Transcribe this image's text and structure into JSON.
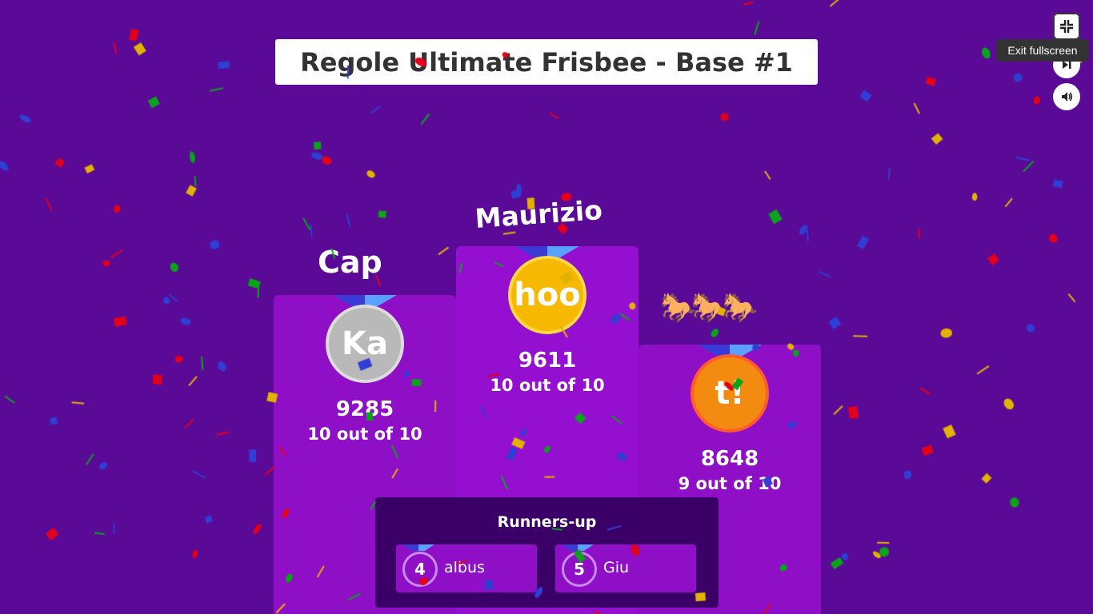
{
  "title": "Regole Ultimate Frisbee - Base #1",
  "controls": {
    "tooltip": "Exit fullscreen",
    "fullscreen_icon": "exit-fullscreen-icon",
    "skip_icon": "skip-icon",
    "volume_icon": "volume-icon"
  },
  "podium": {
    "first": {
      "name": "Maurizio",
      "avatar": "hoo",
      "score": "9611",
      "correct": "10 out of 10",
      "medal_color": "#f6b800"
    },
    "second": {
      "name": "Cap",
      "avatar": "Ka",
      "score": "9285",
      "correct": "10 out of 10",
      "medal_color": "#b9b9b9"
    },
    "third": {
      "name": "🐎🐎🐎",
      "avatar": "t!",
      "score": "8648",
      "correct": "9 out of 10",
      "medal_color": "#f38b10"
    }
  },
  "runners_up": {
    "title": "Runners-up",
    "items": [
      {
        "rank": "4",
        "name": "albus"
      },
      {
        "rank": "5",
        "name": "Giu"
      }
    ]
  },
  "colors": {
    "background": "#5a0a96",
    "podium": "#8e0fc6",
    "runners_panel": "#3b0068",
    "confetti": [
      "#e3001b",
      "#0aa31a",
      "#e1b200",
      "#2f3ed4"
    ]
  }
}
